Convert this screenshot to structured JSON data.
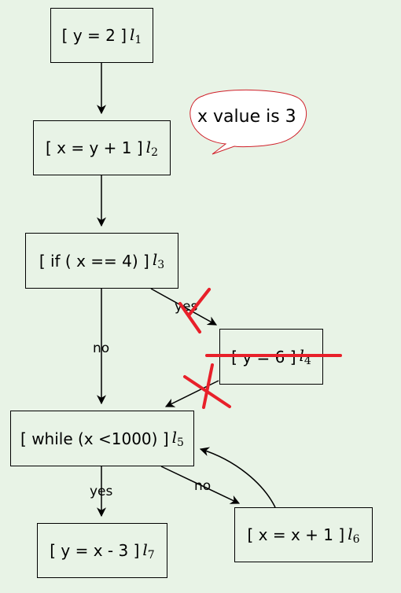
{
  "nodes": {
    "n1": {
      "code": "[ y = 2 ]",
      "label": "l",
      "sub": "1"
    },
    "n2": {
      "code": "[ x = y + 1 ]",
      "label": "l",
      "sub": "2"
    },
    "n3": {
      "code": "[ if ( x == 4) ]",
      "label": "l",
      "sub": "3"
    },
    "n4": {
      "code": "[ y = 6 ]",
      "label": "l",
      "sub": "4"
    },
    "n5": {
      "code": "[ while (x <1000) ]",
      "label": "l",
      "sub": "5"
    },
    "n6": {
      "code": "[ x = x + 1 ]",
      "label": "l",
      "sub": "6"
    },
    "n7": {
      "code": "[ y = x - 3 ]",
      "label": "l",
      "sub": "7"
    }
  },
  "edges": {
    "n3_n4": "yes",
    "n3_n5": "no",
    "n5_n7": "yes",
    "n5_n6": "no"
  },
  "callout": {
    "text": "x value is 3"
  },
  "colors": {
    "background": "#e8f3e6",
    "cross": "#e8202a",
    "callout": "#d0202a"
  }
}
